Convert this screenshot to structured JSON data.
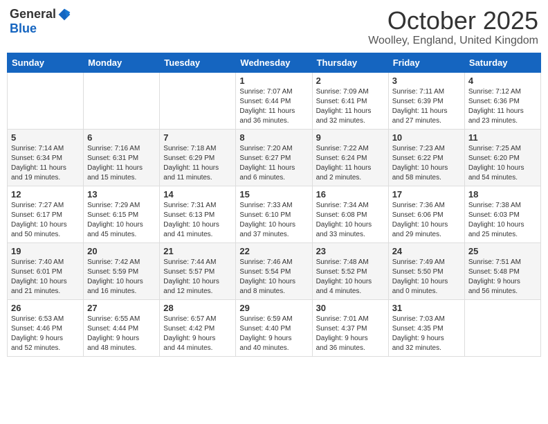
{
  "header": {
    "logo_general": "General",
    "logo_blue": "Blue",
    "month_title": "October 2025",
    "location": "Woolley, England, United Kingdom"
  },
  "weekdays": [
    "Sunday",
    "Monday",
    "Tuesday",
    "Wednesday",
    "Thursday",
    "Friday",
    "Saturday"
  ],
  "weeks": [
    [
      {
        "day": "",
        "info": ""
      },
      {
        "day": "",
        "info": ""
      },
      {
        "day": "",
        "info": ""
      },
      {
        "day": "1",
        "info": "Sunrise: 7:07 AM\nSunset: 6:44 PM\nDaylight: 11 hours\nand 36 minutes."
      },
      {
        "day": "2",
        "info": "Sunrise: 7:09 AM\nSunset: 6:41 PM\nDaylight: 11 hours\nand 32 minutes."
      },
      {
        "day": "3",
        "info": "Sunrise: 7:11 AM\nSunset: 6:39 PM\nDaylight: 11 hours\nand 27 minutes."
      },
      {
        "day": "4",
        "info": "Sunrise: 7:12 AM\nSunset: 6:36 PM\nDaylight: 11 hours\nand 23 minutes."
      }
    ],
    [
      {
        "day": "5",
        "info": "Sunrise: 7:14 AM\nSunset: 6:34 PM\nDaylight: 11 hours\nand 19 minutes."
      },
      {
        "day": "6",
        "info": "Sunrise: 7:16 AM\nSunset: 6:31 PM\nDaylight: 11 hours\nand 15 minutes."
      },
      {
        "day": "7",
        "info": "Sunrise: 7:18 AM\nSunset: 6:29 PM\nDaylight: 11 hours\nand 11 minutes."
      },
      {
        "day": "8",
        "info": "Sunrise: 7:20 AM\nSunset: 6:27 PM\nDaylight: 11 hours\nand 6 minutes."
      },
      {
        "day": "9",
        "info": "Sunrise: 7:22 AM\nSunset: 6:24 PM\nDaylight: 11 hours\nand 2 minutes."
      },
      {
        "day": "10",
        "info": "Sunrise: 7:23 AM\nSunset: 6:22 PM\nDaylight: 10 hours\nand 58 minutes."
      },
      {
        "day": "11",
        "info": "Sunrise: 7:25 AM\nSunset: 6:20 PM\nDaylight: 10 hours\nand 54 minutes."
      }
    ],
    [
      {
        "day": "12",
        "info": "Sunrise: 7:27 AM\nSunset: 6:17 PM\nDaylight: 10 hours\nand 50 minutes."
      },
      {
        "day": "13",
        "info": "Sunrise: 7:29 AM\nSunset: 6:15 PM\nDaylight: 10 hours\nand 45 minutes."
      },
      {
        "day": "14",
        "info": "Sunrise: 7:31 AM\nSunset: 6:13 PM\nDaylight: 10 hours\nand 41 minutes."
      },
      {
        "day": "15",
        "info": "Sunrise: 7:33 AM\nSunset: 6:10 PM\nDaylight: 10 hours\nand 37 minutes."
      },
      {
        "day": "16",
        "info": "Sunrise: 7:34 AM\nSunset: 6:08 PM\nDaylight: 10 hours\nand 33 minutes."
      },
      {
        "day": "17",
        "info": "Sunrise: 7:36 AM\nSunset: 6:06 PM\nDaylight: 10 hours\nand 29 minutes."
      },
      {
        "day": "18",
        "info": "Sunrise: 7:38 AM\nSunset: 6:03 PM\nDaylight: 10 hours\nand 25 minutes."
      }
    ],
    [
      {
        "day": "19",
        "info": "Sunrise: 7:40 AM\nSunset: 6:01 PM\nDaylight: 10 hours\nand 21 minutes."
      },
      {
        "day": "20",
        "info": "Sunrise: 7:42 AM\nSunset: 5:59 PM\nDaylight: 10 hours\nand 16 minutes."
      },
      {
        "day": "21",
        "info": "Sunrise: 7:44 AM\nSunset: 5:57 PM\nDaylight: 10 hours\nand 12 minutes."
      },
      {
        "day": "22",
        "info": "Sunrise: 7:46 AM\nSunset: 5:54 PM\nDaylight: 10 hours\nand 8 minutes."
      },
      {
        "day": "23",
        "info": "Sunrise: 7:48 AM\nSunset: 5:52 PM\nDaylight: 10 hours\nand 4 minutes."
      },
      {
        "day": "24",
        "info": "Sunrise: 7:49 AM\nSunset: 5:50 PM\nDaylight: 10 hours\nand 0 minutes."
      },
      {
        "day": "25",
        "info": "Sunrise: 7:51 AM\nSunset: 5:48 PM\nDaylight: 9 hours\nand 56 minutes."
      }
    ],
    [
      {
        "day": "26",
        "info": "Sunrise: 6:53 AM\nSunset: 4:46 PM\nDaylight: 9 hours\nand 52 minutes."
      },
      {
        "day": "27",
        "info": "Sunrise: 6:55 AM\nSunset: 4:44 PM\nDaylight: 9 hours\nand 48 minutes."
      },
      {
        "day": "28",
        "info": "Sunrise: 6:57 AM\nSunset: 4:42 PM\nDaylight: 9 hours\nand 44 minutes."
      },
      {
        "day": "29",
        "info": "Sunrise: 6:59 AM\nSunset: 4:40 PM\nDaylight: 9 hours\nand 40 minutes."
      },
      {
        "day": "30",
        "info": "Sunrise: 7:01 AM\nSunset: 4:37 PM\nDaylight: 9 hours\nand 36 minutes."
      },
      {
        "day": "31",
        "info": "Sunrise: 7:03 AM\nSunset: 4:35 PM\nDaylight: 9 hours\nand 32 minutes."
      },
      {
        "day": "",
        "info": ""
      }
    ]
  ]
}
